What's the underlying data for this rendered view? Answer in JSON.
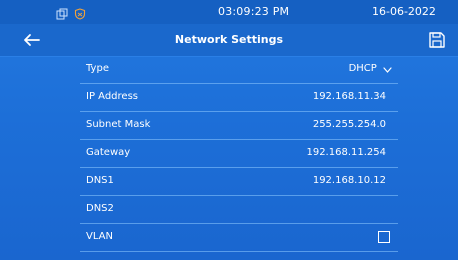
{
  "status_bar": {
    "time": "03:09:23   PM",
    "date": "16-06-2022"
  },
  "header": {
    "title": "Network Settings"
  },
  "icons": {
    "back": "back-arrow-icon",
    "save": "save-icon",
    "type_dropdown": "chevron-down-icon"
  },
  "rows": {
    "type": {
      "label": "Type",
      "value": "DHCP"
    },
    "ip": {
      "label": "IP Address",
      "value": "192.168.11.34"
    },
    "subnet": {
      "label": "Subnet Mask",
      "value": "255.255.254.0"
    },
    "gateway": {
      "label": "Gateway",
      "value": "192.168.11.254"
    },
    "dns1": {
      "label": "DNS1",
      "value": "192.168.10.12"
    },
    "dns2": {
      "label": "DNS2",
      "value": ""
    },
    "vlan": {
      "label": "VLAN",
      "checked": false
    }
  },
  "colors": {
    "background": "#1d6fd8",
    "status_bar": "#1560c2",
    "divider": "#8cc8ff",
    "text": "#ffffff"
  }
}
